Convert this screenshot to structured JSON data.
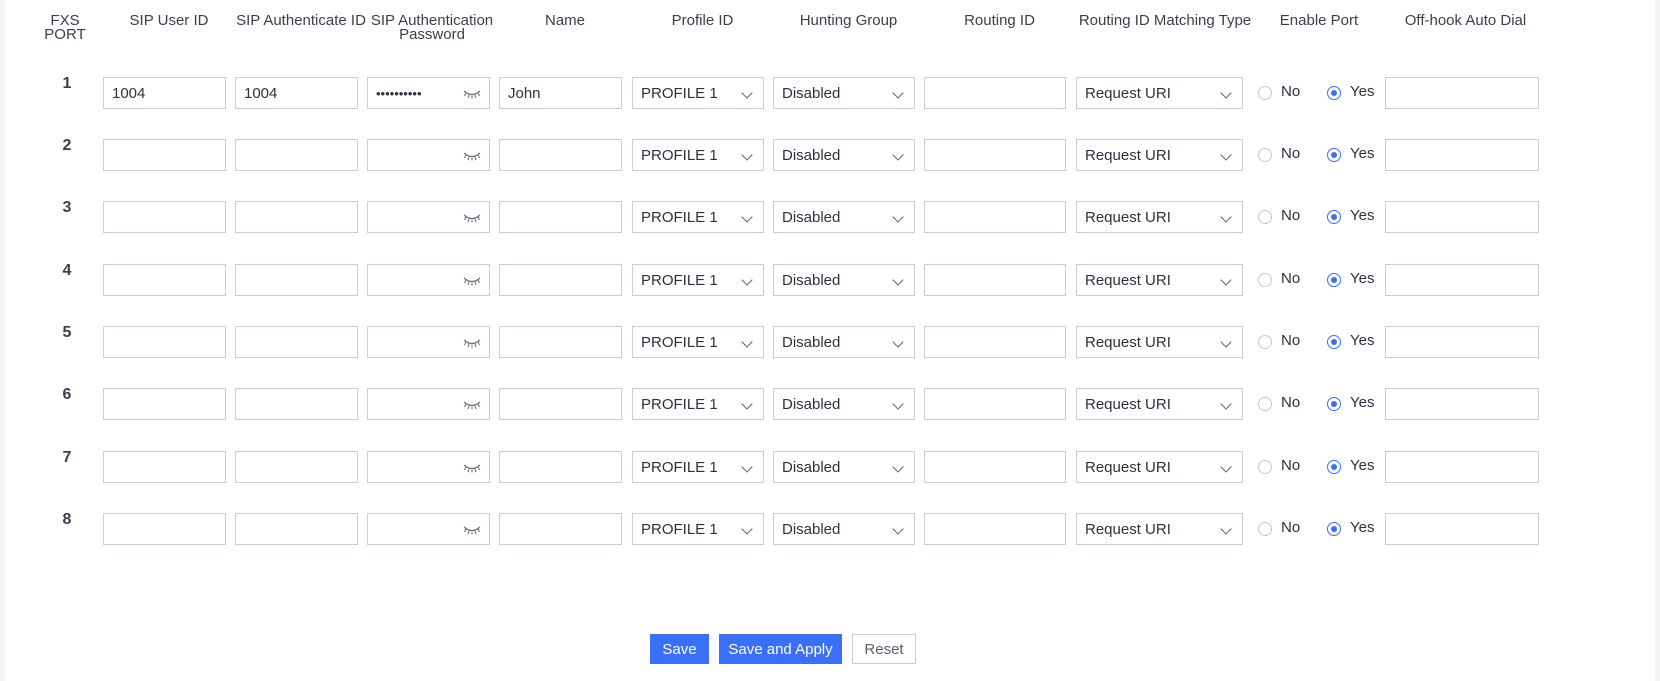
{
  "headers": {
    "fxs_port": "FXS PORT",
    "sip_user_id": "SIP User ID",
    "sip_auth_id": "SIP Authenticate ID",
    "sip_auth_password_line1": "SIP Authentication",
    "sip_auth_password_line2": "Password",
    "name": "Name",
    "profile_id": "Profile ID",
    "hunting_group": "Hunting Group",
    "routing_id": "Routing ID",
    "routing_id_matching_type": "Routing ID Matching Type",
    "enable_port": "Enable Port",
    "offhook_auto_dial": "Off-hook Auto Dial"
  },
  "rows": [
    {
      "port": "1",
      "sip_user_id": "1004",
      "sip_auth_id": "1004",
      "password_dots": "••••••••••",
      "name": "John",
      "profile": "PROFILE 1",
      "hunting": "Disabled",
      "routing_id": "",
      "matching": "Request URI",
      "enable": "yes",
      "offhook": ""
    },
    {
      "port": "2",
      "sip_user_id": "",
      "sip_auth_id": "",
      "password_dots": "",
      "name": "",
      "profile": "PROFILE 1",
      "hunting": "Disabled",
      "routing_id": "",
      "matching": "Request URI",
      "enable": "yes",
      "offhook": ""
    },
    {
      "port": "3",
      "sip_user_id": "",
      "sip_auth_id": "",
      "password_dots": "",
      "name": "",
      "profile": "PROFILE 1",
      "hunting": "Disabled",
      "routing_id": "",
      "matching": "Request URI",
      "enable": "yes",
      "offhook": ""
    },
    {
      "port": "4",
      "sip_user_id": "",
      "sip_auth_id": "",
      "password_dots": "",
      "name": "",
      "profile": "PROFILE 1",
      "hunting": "Disabled",
      "routing_id": "",
      "matching": "Request URI",
      "enable": "yes",
      "offhook": ""
    },
    {
      "port": "5",
      "sip_user_id": "",
      "sip_auth_id": "",
      "password_dots": "",
      "name": "",
      "profile": "PROFILE 1",
      "hunting": "Disabled",
      "routing_id": "",
      "matching": "Request URI",
      "enable": "yes",
      "offhook": ""
    },
    {
      "port": "6",
      "sip_user_id": "",
      "sip_auth_id": "",
      "password_dots": "",
      "name": "",
      "profile": "PROFILE 1",
      "hunting": "Disabled",
      "routing_id": "",
      "matching": "Request URI",
      "enable": "yes",
      "offhook": ""
    },
    {
      "port": "7",
      "sip_user_id": "",
      "sip_auth_id": "",
      "password_dots": "",
      "name": "",
      "profile": "PROFILE 1",
      "hunting": "Disabled",
      "routing_id": "",
      "matching": "Request URI",
      "enable": "yes",
      "offhook": ""
    },
    {
      "port": "8",
      "sip_user_id": "",
      "sip_auth_id": "",
      "password_dots": "",
      "name": "",
      "profile": "PROFILE 1",
      "hunting": "Disabled",
      "routing_id": "",
      "matching": "Request URI",
      "enable": "yes",
      "offhook": ""
    }
  ],
  "radio_labels": {
    "no": "No",
    "yes": "Yes"
  },
  "buttons": {
    "save": "Save",
    "save_and_apply": "Save and Apply",
    "reset": "Reset"
  },
  "colors": {
    "accent": "#3a6ff7",
    "border": "#c9cdd6",
    "text": "#2c3140"
  }
}
